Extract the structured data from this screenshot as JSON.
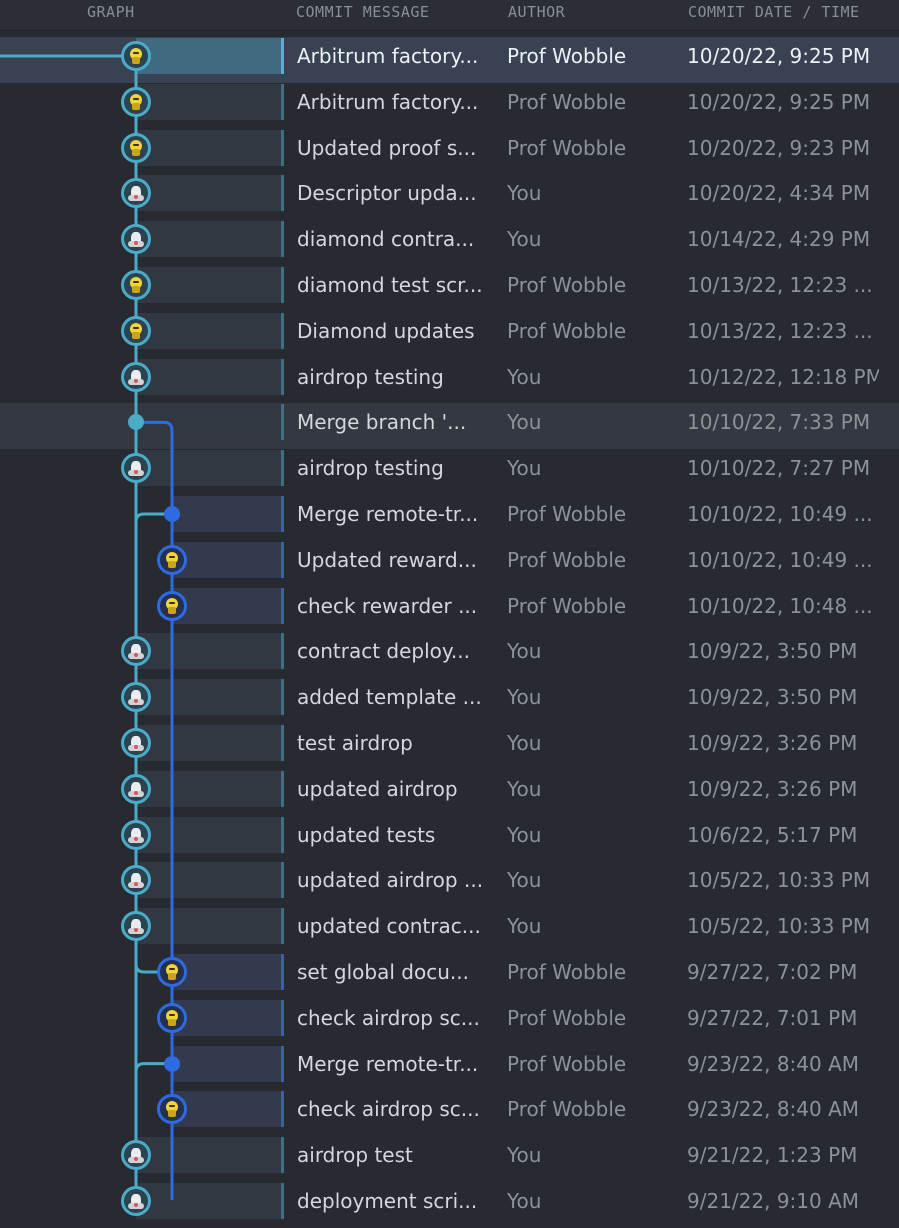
{
  "header": {
    "graph": "GRAPH",
    "message": "COMMIT MESSAGE",
    "author": "AUTHOR",
    "date": "COMMIT DATE / TIME"
  },
  "colors": {
    "lane_main": "#4bacc9",
    "lane_branch": "#2f6be0",
    "selected_row": "#394253"
  },
  "commits": [
    {
      "message": "Arbitrum factory...",
      "author": "Prof Wobble",
      "date": "10/20/22, 9:25 PM",
      "lane": 0,
      "node": "avatar",
      "avatar": "prof-wobble-avatar",
      "selected": true
    },
    {
      "message": "Arbitrum factory...",
      "author": "Prof Wobble",
      "date": "10/20/22, 9:25 PM",
      "lane": 0,
      "node": "avatar",
      "avatar": "prof-wobble-avatar"
    },
    {
      "message": "Updated proof s...",
      "author": "Prof Wobble",
      "date": "10/20/22, 9:23 PM",
      "lane": 0,
      "node": "avatar",
      "avatar": "prof-wobble-avatar"
    },
    {
      "message": "Descriptor upda...",
      "author": "You",
      "date": "10/20/22, 4:34 PM",
      "lane": 0,
      "node": "avatar",
      "avatar": "you-avatar"
    },
    {
      "message": "diamond contra...",
      "author": "You",
      "date": "10/14/22, 4:29 PM",
      "lane": 0,
      "node": "avatar",
      "avatar": "you-avatar"
    },
    {
      "message": "diamond test scr...",
      "author": "Prof Wobble",
      "date": "10/13/22, 12:23 ...",
      "lane": 0,
      "node": "avatar",
      "avatar": "prof-wobble-avatar"
    },
    {
      "message": "Diamond updates",
      "author": "Prof Wobble",
      "date": "10/13/22, 12:23 ...",
      "lane": 0,
      "node": "avatar",
      "avatar": "prof-wobble-avatar"
    },
    {
      "message": "airdrop testing",
      "author": "You",
      "date": "10/12/22, 12:18 PM",
      "lane": 0,
      "node": "avatar",
      "avatar": "you-avatar"
    },
    {
      "message": "Merge branch '...",
      "author": "You",
      "date": "10/10/22, 7:33 PM",
      "lane": 0,
      "node": "dot",
      "hover": true
    },
    {
      "message": "airdrop testing",
      "author": "You",
      "date": "10/10/22, 7:27 PM",
      "lane": 0,
      "node": "avatar",
      "avatar": "you-avatar"
    },
    {
      "message": "Merge remote-tr...",
      "author": "Prof Wobble",
      "date": "10/10/22, 10:49 ...",
      "lane": 1,
      "node": "dot"
    },
    {
      "message": "Updated reward...",
      "author": "Prof Wobble",
      "date": "10/10/22, 10:49 ...",
      "lane": 1,
      "node": "avatar",
      "avatar": "prof-wobble-avatar"
    },
    {
      "message": "check rewarder ...",
      "author": "Prof Wobble",
      "date": "10/10/22, 10:48 ...",
      "lane": 1,
      "node": "avatar",
      "avatar": "prof-wobble-avatar"
    },
    {
      "message": "contract deploy...",
      "author": "You",
      "date": "10/9/22, 3:50 PM",
      "lane": 0,
      "node": "avatar",
      "avatar": "you-avatar"
    },
    {
      "message": "added template ...",
      "author": "You",
      "date": "10/9/22, 3:50 PM",
      "lane": 0,
      "node": "avatar",
      "avatar": "you-avatar"
    },
    {
      "message": "test airdrop",
      "author": "You",
      "date": "10/9/22, 3:26 PM",
      "lane": 0,
      "node": "avatar",
      "avatar": "you-avatar"
    },
    {
      "message": "updated airdrop",
      "author": "You",
      "date": "10/9/22, 3:26 PM",
      "lane": 0,
      "node": "avatar",
      "avatar": "you-avatar"
    },
    {
      "message": "updated tests",
      "author": "You",
      "date": "10/6/22, 5:17 PM",
      "lane": 0,
      "node": "avatar",
      "avatar": "you-avatar"
    },
    {
      "message": "updated airdrop ...",
      "author": "You",
      "date": "10/5/22, 10:33 PM",
      "lane": 0,
      "node": "avatar",
      "avatar": "you-avatar"
    },
    {
      "message": "updated contrac...",
      "author": "You",
      "date": "10/5/22, 10:33 PM",
      "lane": 0,
      "node": "avatar",
      "avatar": "you-avatar"
    },
    {
      "message": "set global docu...",
      "author": "Prof Wobble",
      "date": "9/27/22, 7:02 PM",
      "lane": 1,
      "node": "avatar",
      "avatar": "prof-wobble-avatar"
    },
    {
      "message": "check airdrop sc...",
      "author": "Prof Wobble",
      "date": "9/27/22, 7:01 PM",
      "lane": 1,
      "node": "avatar",
      "avatar": "prof-wobble-avatar"
    },
    {
      "message": "Merge remote-tr...",
      "author": "Prof Wobble",
      "date": "9/23/22, 8:40 AM",
      "lane": 1,
      "node": "dot"
    },
    {
      "message": "check airdrop sc...",
      "author": "Prof Wobble",
      "date": "9/23/22, 8:40 AM",
      "lane": 1,
      "node": "avatar",
      "avatar": "prof-wobble-avatar"
    },
    {
      "message": "airdrop test",
      "author": "You",
      "date": "9/21/22, 1:23 PM",
      "lane": 0,
      "node": "avatar",
      "avatar": "you-avatar"
    },
    {
      "message": "deployment scri...",
      "author": "You",
      "date": "9/21/22, 9:10 AM",
      "lane": 0,
      "node": "avatar",
      "avatar": "you-avatar"
    }
  ]
}
